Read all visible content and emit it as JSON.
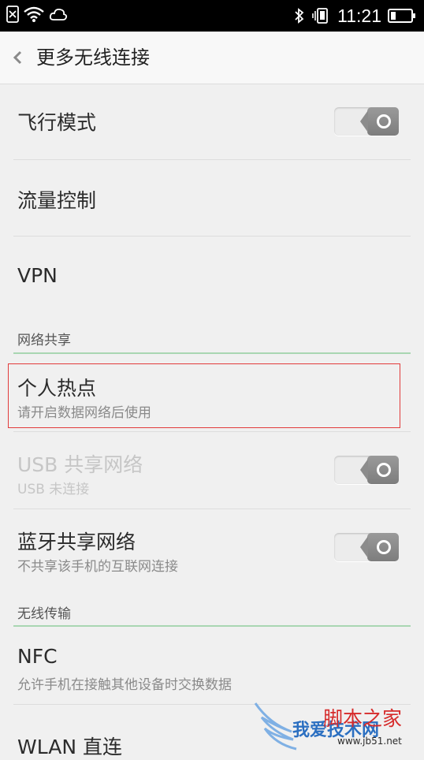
{
  "status_bar": {
    "time": "11:21",
    "icons_left": [
      "sim-x-icon",
      "wifi-icon",
      "cloud-icon"
    ],
    "icons_right": [
      "bluetooth-icon",
      "vibrate-icon",
      "battery-icon"
    ]
  },
  "header": {
    "title": "更多无线连接"
  },
  "rows": {
    "airplane": {
      "label": "飞行模式",
      "enabled": false
    },
    "data_control": {
      "label": "流量控制"
    },
    "vpn": {
      "label": "VPN"
    },
    "hotspot": {
      "label": "个人热点",
      "sub": "请开启数据网络后使用"
    },
    "usb_tether": {
      "label": "USB 共享网络",
      "sub": "USB 未连接",
      "enabled": false
    },
    "bt_tether": {
      "label": "蓝牙共享网络",
      "sub": "不共享该手机的互联网连接",
      "enabled": false
    },
    "nfc": {
      "label": "NFC",
      "sub": "允许手机在接触其他设备时交换数据"
    },
    "wlan_direct": {
      "label": "WLAN 直连"
    }
  },
  "sections": {
    "network_share": "网络共享",
    "wireless_transfer": "无线传输"
  },
  "watermark": {
    "brand_red": "脚本之家",
    "brand_blue": "我爱技术网",
    "url": "www.jb51.net"
  }
}
